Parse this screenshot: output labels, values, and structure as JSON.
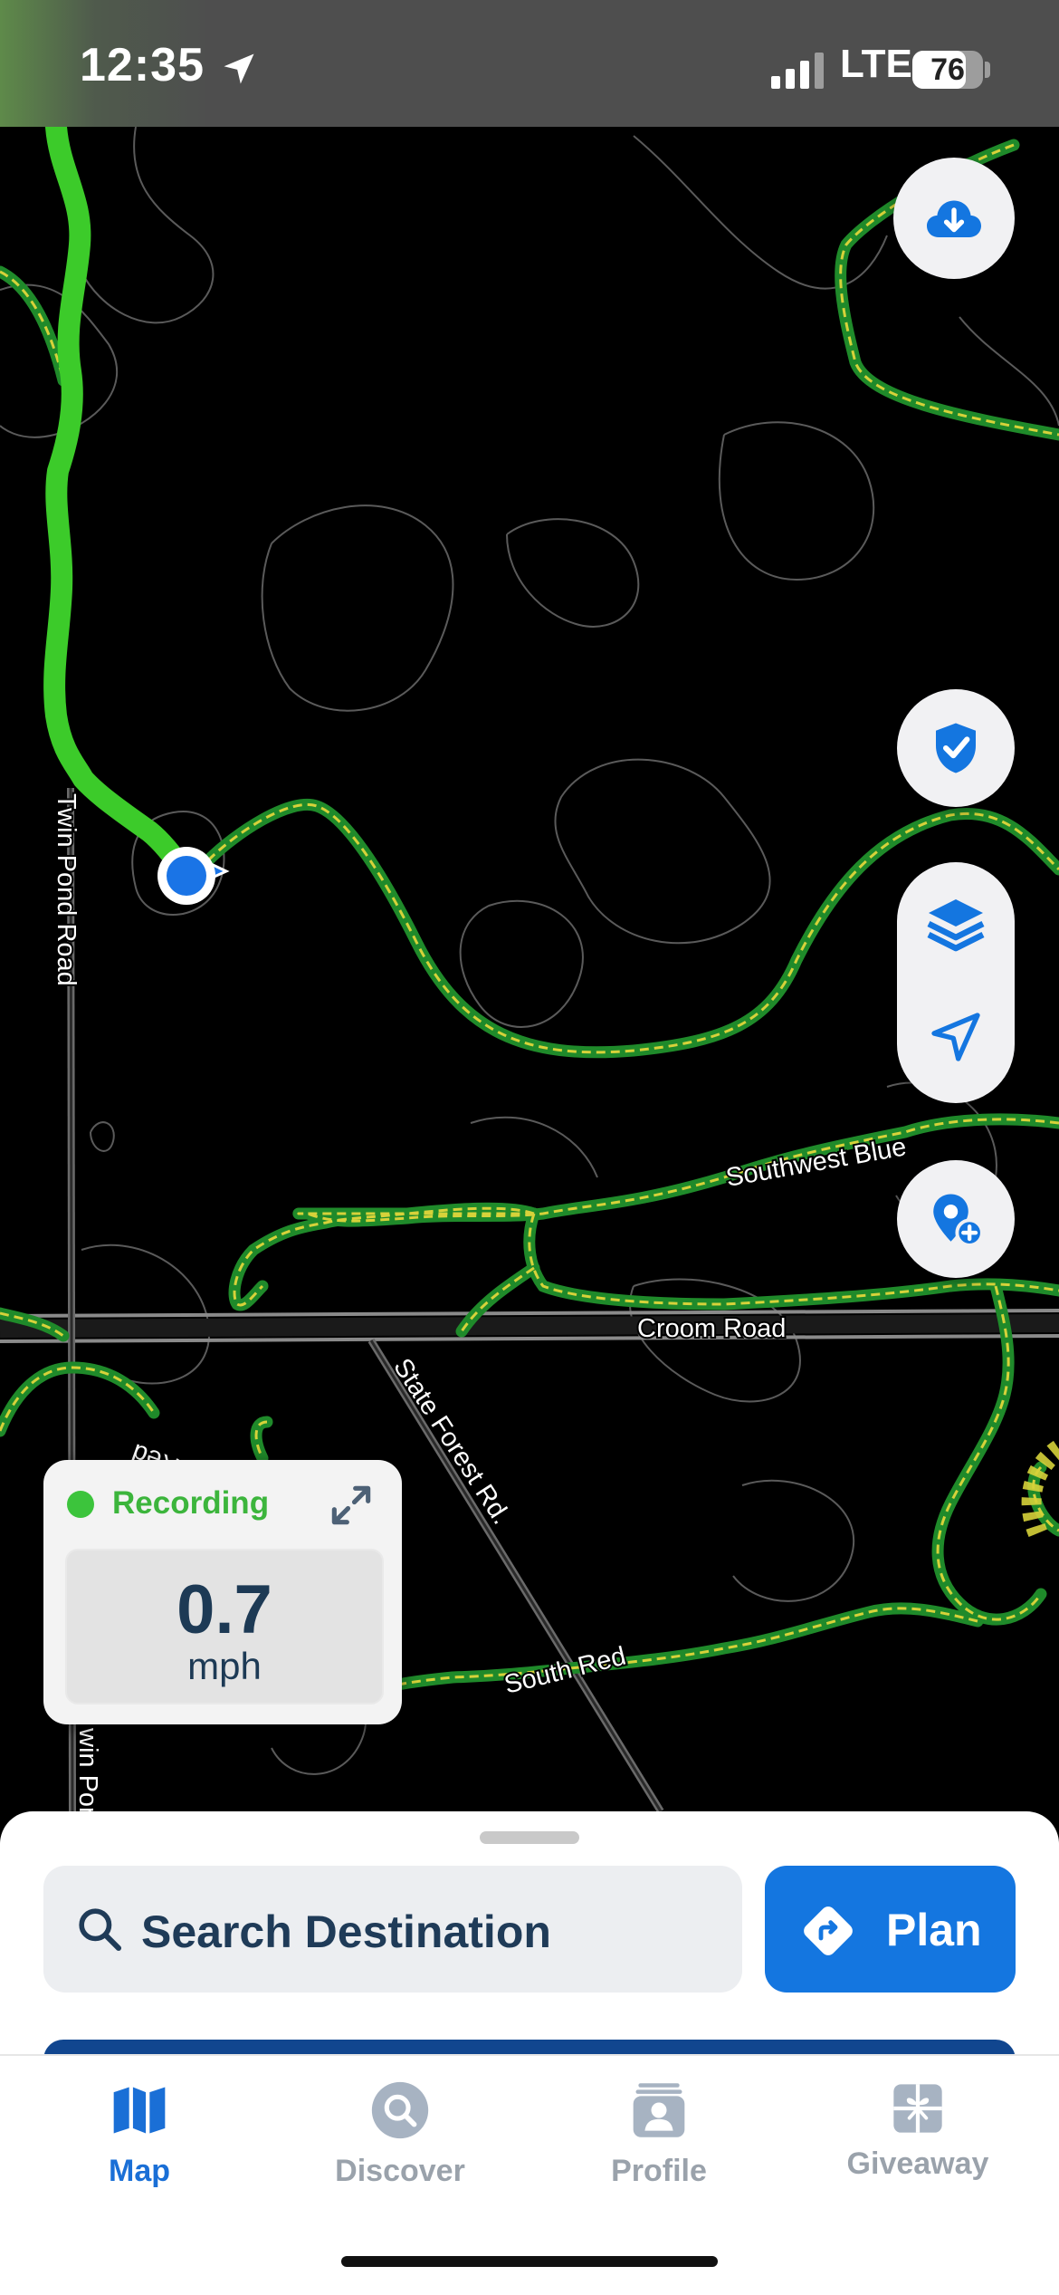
{
  "status_bar": {
    "time": "12:35",
    "network": "LTE",
    "battery_percent": 76,
    "battery_label": "76"
  },
  "map": {
    "road_labels": {
      "twin_pond_road": "Twin Pond Road",
      "southwest_blue": "Southwest Blue",
      "croom_road": "Croom Road",
      "state_forest_rd": "State Forest Rd.",
      "south_red": "South Red",
      "red": "Red",
      "twin_pond_partial": "win Pond"
    },
    "controls": {
      "download_icon": "cloud-download-icon",
      "shield_icon": "shield-check-icon",
      "layers_icon": "layers-icon",
      "locate_icon": "navigation-arrow-icon",
      "add_pin_icon": "pin-add-icon"
    },
    "colors": {
      "track": "#3ccb2a",
      "trail_outline": "#1f8a2a",
      "trail_dash": "#d6d23a",
      "accent": "#1476e0"
    }
  },
  "recording": {
    "status": "Recording",
    "speed_value": "0.7",
    "speed_unit": "mph"
  },
  "bottom_sheet": {
    "search_placeholder": "Search Destination",
    "plan_label": "Plan"
  },
  "tabs": [
    {
      "label": "Map",
      "icon": "map-icon",
      "active": true
    },
    {
      "label": "Discover",
      "icon": "discover-icon",
      "active": false
    },
    {
      "label": "Profile",
      "icon": "profile-icon",
      "active": false
    },
    {
      "label": "Giveaway",
      "icon": "gift-icon",
      "active": false
    }
  ]
}
